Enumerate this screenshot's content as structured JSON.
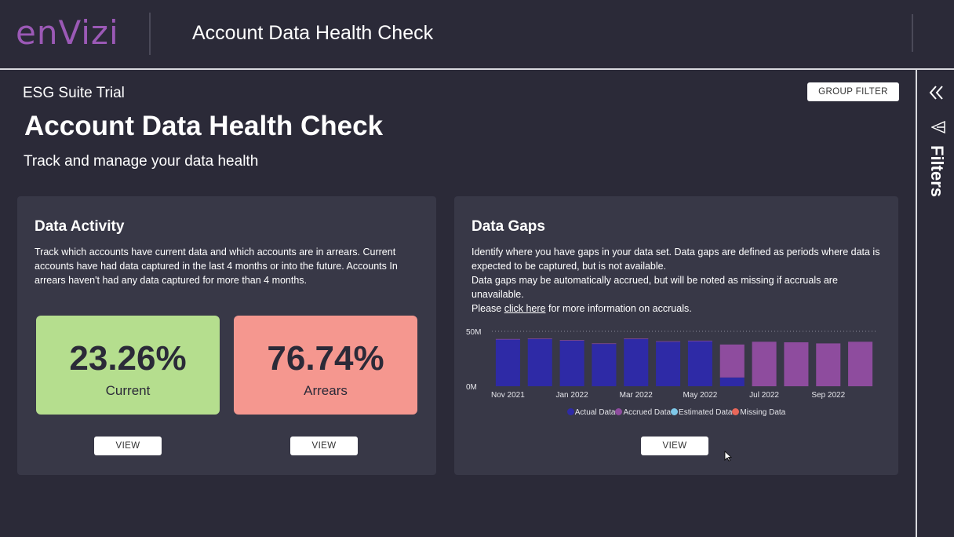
{
  "header": {
    "logo_text": "enVizi",
    "app_title": "Account Data Health Check"
  },
  "side_panel": {
    "label": "Filters",
    "collapse_icon": "double-chevron-left-icon",
    "filter_icon": "funnel-icon"
  },
  "page": {
    "environment": "ESG Suite Trial",
    "group_filter_label": "GROUP FILTER",
    "title": "Account Data Health Check",
    "subtitle": "Track and manage your data health"
  },
  "data_activity": {
    "title": "Data Activity",
    "description": "Track which accounts have current data and which accounts are in arrears.  Current accounts have had data captured in the last 4 months or into the future.  Accounts In arrears haven't had any data captured for more than 4 months.",
    "current_value": "23.26%",
    "current_label": "Current",
    "arrears_value": "76.74%",
    "arrears_label": "Arrears",
    "view_label_1": "VIEW",
    "view_label_2": "VIEW",
    "colors": {
      "current": "#b5de8e",
      "arrears": "#f5978f"
    }
  },
  "data_gaps": {
    "title": "Data Gaps",
    "description_line1": "Identify where you have gaps in your data set. Data gaps are defined as periods where data is expected to be captured, but is not available.",
    "description_line2": "Data gaps may be automatically accrued, but will be noted as missing if accruals are unavailable.",
    "description_line3_pre": "Please ",
    "description_link": "click here",
    "description_line3_post": " for more information on accruals.",
    "view_label": "VIEW"
  },
  "chart_data": {
    "type": "bar",
    "stacked": true,
    "categories": [
      "Nov 2021",
      "Dec 2021",
      "Jan 2022",
      "Feb 2022",
      "Mar 2022",
      "Apr 2022",
      "May 2022",
      "Jun 2022",
      "Jul 2022",
      "Aug 2022",
      "Sep 2022",
      "Oct 2022"
    ],
    "tick_labels": [
      "Nov 2021",
      "Jan 2022",
      "Mar 2022",
      "May 2022",
      "Jul 2022",
      "Sep 2022"
    ],
    "tick_indices": [
      0,
      2,
      4,
      6,
      8,
      10
    ],
    "y_tick_labels": [
      "50M",
      "0M"
    ],
    "ylim": [
      0,
      50
    ],
    "grid": true,
    "legend_position": "bottom",
    "series": [
      {
        "name": "Actual Data",
        "color": "#2e2aa6",
        "values": [
          42.5,
          43,
          41.5,
          38.5,
          43,
          40.5,
          41,
          8,
          0,
          0,
          0,
          0
        ]
      },
      {
        "name": "Accrued Data",
        "color": "#8e4c9e",
        "values": [
          0.5,
          0.5,
          0.5,
          0.5,
          0.5,
          0.5,
          0.5,
          30,
          40.5,
          40,
          39,
          40.5
        ]
      },
      {
        "name": "Estimated Data",
        "color": "#7fc8e8",
        "values": [
          0,
          0,
          0,
          0,
          0,
          0,
          0,
          0,
          0,
          0,
          0,
          0
        ]
      },
      {
        "name": "Missing Data",
        "color": "#e8675a",
        "values": [
          0,
          0,
          0,
          0,
          0,
          0,
          0,
          0,
          0,
          0,
          0,
          0
        ]
      }
    ]
  }
}
